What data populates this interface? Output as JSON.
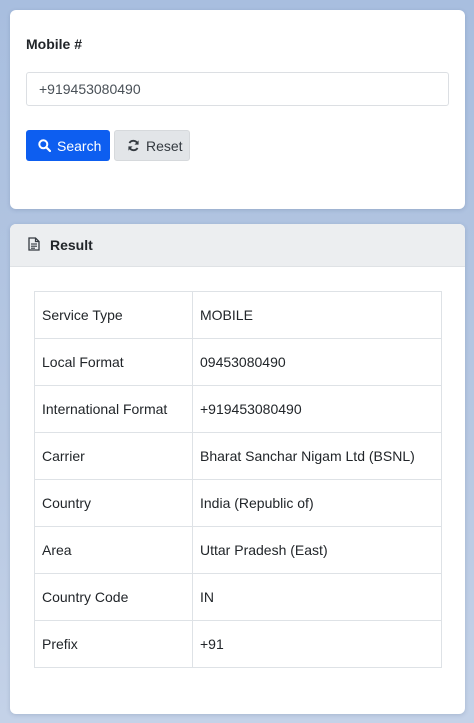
{
  "form": {
    "label": "Mobile #",
    "input_value": "+919453080490",
    "search_label": "Search",
    "reset_label": "Reset"
  },
  "result": {
    "title": "Result",
    "rows": [
      {
        "key": "Service Type",
        "value": "MOBILE"
      },
      {
        "key": "Local Format",
        "value": "09453080490"
      },
      {
        "key": "International Format",
        "value": "+919453080490"
      },
      {
        "key": "Carrier",
        "value": "Bharat Sanchar Nigam Ltd (BSNL)"
      },
      {
        "key": "Country",
        "value": "India (Republic of)"
      },
      {
        "key": "Area",
        "value": "Uttar Pradesh (East)"
      },
      {
        "key": "Country Code",
        "value": "IN"
      },
      {
        "key": "Prefix",
        "value": "+91"
      }
    ]
  },
  "icons": {
    "search": "search-icon",
    "reset": "refresh-icon",
    "result": "document-icon"
  },
  "colors": {
    "primary": "#0d5ef0",
    "secondary": "#e2e5e8",
    "background": "#b7c8e2"
  }
}
